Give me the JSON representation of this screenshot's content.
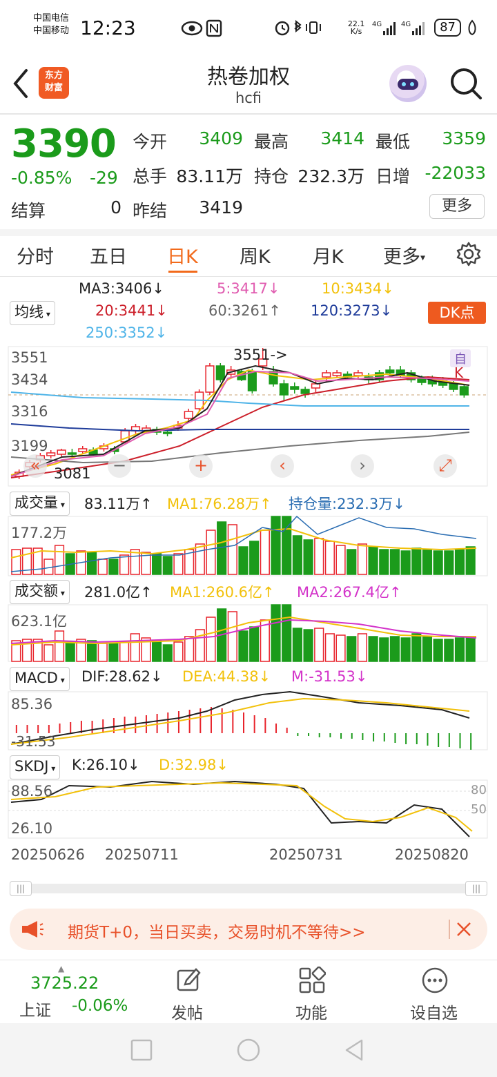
{
  "status_bar": {
    "carrier1": "中国电信",
    "carrier2": "中国移动",
    "time": "12:23",
    "net_speed": "22.1 K/s",
    "battery": "87"
  },
  "header": {
    "app_logo_line1": "东方",
    "app_logo_line2": "财富",
    "title": "热卷加权",
    "code": "hcfi"
  },
  "quote": {
    "price": "3390",
    "change_pct": "-0.85%",
    "change": "-29",
    "open_label": "今开",
    "open": "3409",
    "high_label": "最高",
    "high": "3414",
    "low_label": "最低",
    "low": "3359",
    "volume_label": "总手",
    "volume": "83.11万",
    "position_label": "持仓",
    "position": "232.3万",
    "daily_inc_label": "日增",
    "daily_inc": "-22033",
    "settle_label": "结算",
    "settle": "0",
    "prev_settle_label": "昨结",
    "prev_settle": "3419",
    "more_label": "更多"
  },
  "tabs": [
    "分时",
    "五日",
    "日K",
    "周K",
    "月K",
    "更多"
  ],
  "ma_legend": {
    "selector": "均线",
    "ma3": "MA3:3406↓",
    "ma5": "5:3417↓",
    "ma10": "10:3434↓",
    "ma20": "20:3441↓",
    "ma60": "60:3261↑",
    "ma120": "120:3273↓",
    "ma250": "250:3352↓",
    "dk_button": "DK点"
  },
  "kline": {
    "y_labels": [
      "3551",
      "3434",
      "3316",
      "3199"
    ],
    "max_marker": "3551->",
    "min_marker": "3081",
    "self_marker_1": "自",
    "self_marker_2": "K"
  },
  "volume_panel": {
    "selector": "成交量",
    "value": "83.11万↑",
    "ma1": "MA1:76.28万↑",
    "oi": "持仓量:232.3万↓",
    "y_max": "177.2万"
  },
  "amount_panel": {
    "selector": "成交额",
    "value": "281.0亿↑",
    "ma1": "MA1:260.6亿↑",
    "ma2": "MA2:267.4亿↑",
    "y_max": "623.1亿"
  },
  "macd_panel": {
    "selector": "MACD",
    "dif": "DIF:28.62↓",
    "dea": "DEA:44.38↓",
    "m": "M:-31.53↓",
    "y_top": "85.36",
    "y_bottom": "-31.53"
  },
  "skdj_panel": {
    "selector": "SKDJ",
    "k": "K:26.10↓",
    "d": "D:32.98↓",
    "y_top": "88.56",
    "y_bottom": "26.10",
    "r80": "80",
    "r50": "50"
  },
  "x_dates": [
    "20250626",
    "20250711",
    "20250731",
    "20250820"
  ],
  "banner": {
    "text": "期货T+0，当日买卖，交易时机不等待>>"
  },
  "bottom_bar": {
    "index_value": "3725.22",
    "index_name": "上证",
    "index_change": "-0.06%",
    "post_label": "发帖",
    "function_label": "功能",
    "watchlist_label": "设自选"
  },
  "colors": {
    "up": "#e8232b",
    "down": "#1b9b1b",
    "accent": "#f26a1b"
  },
  "chart_data": {
    "type": "candlestick",
    "series": [
      {
        "name": "MA3",
        "latest": 3406
      },
      {
        "name": "5",
        "latest": 3417
      },
      {
        "name": "10",
        "latest": 3434
      },
      {
        "name": "20",
        "latest": 3441
      },
      {
        "name": "60",
        "latest": 3261
      },
      {
        "name": "120",
        "latest": 3273
      },
      {
        "name": "250",
        "latest": 3352
      }
    ],
    "x": [
      "20250626",
      "20250711",
      "20250731",
      "20250820"
    ],
    "y_ticks": [
      3551,
      3434,
      3316,
      3199
    ],
    "max": 3551,
    "min": 3081
  }
}
